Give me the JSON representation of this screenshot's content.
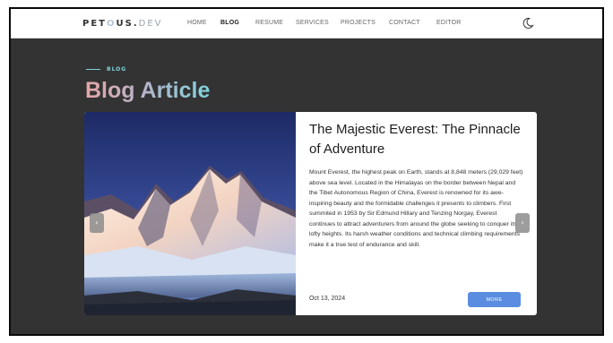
{
  "brand": {
    "logo_pre": "PET",
    "logo_blur": "O",
    "logo_mid": "US.",
    "logo_tld": "DEV"
  },
  "nav": {
    "items": [
      {
        "label": "HOME",
        "active": false
      },
      {
        "label": "BLOG",
        "active": true
      },
      {
        "label": "RESUME",
        "active": false
      },
      {
        "label": "SERVICES",
        "active": false
      },
      {
        "label": "PROJECTS",
        "active": false
      },
      {
        "label": "CONTACT",
        "active": false
      },
      {
        "label": "EDITOR",
        "active": false
      }
    ],
    "theme_icon": "moon-icon"
  },
  "section": {
    "eyebrow": "BLOG",
    "title": "Blog Article"
  },
  "article": {
    "title": "The Majestic Everest: The Pinnacle of Adventure",
    "body": "Mount Everest, the highest peak on Earth, stands at 8,848 meters (29,029 feet) above sea level. Located in the Himalayas on the border between Nepal and the Tibet Autonomous Region of China, Everest is renowned for its awe-inspiring beauty and the formidable challenges it presents to climbers. First summited in 1953 by Sir Edmund Hillary and Tenzing Norgay, Everest continues to attract adventurers from around the globe seeking to conquer its lofty heights. Its harsh weather conditions and technical climbing requirements make it a true test of endurance and skill.",
    "date": "Oct 13, 2024",
    "more_label": "MORE",
    "image": "mountain-everest-photo"
  },
  "carousel": {
    "prev_icon": "chevron-left-icon",
    "next_icon": "chevron-right-icon",
    "prev_glyph": "‹",
    "next_glyph": "›"
  },
  "colors": {
    "background": "#333333",
    "accent": "#7fd3dc",
    "button": "#5a8de0"
  }
}
